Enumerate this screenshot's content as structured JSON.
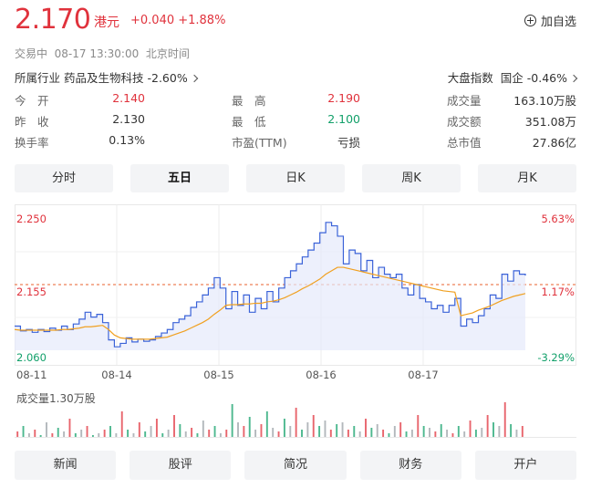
{
  "header": {
    "price": "2.170",
    "currency": "港元",
    "change": "+0.040 +1.88%",
    "watch_label": "加自选"
  },
  "status": {
    "state": "交易中",
    "time": "08-17 13:30:00",
    "zone": "北京时间"
  },
  "industry": {
    "label": "所属行业",
    "name": "药品及生物科技",
    "change": "-2.60%"
  },
  "market_index": {
    "label": "大盘指数",
    "name": "国企",
    "change": "-0.46%"
  },
  "stats": [
    [
      {
        "label": "今　开",
        "value": "2.140",
        "color": "red"
      },
      {
        "label": "最　高",
        "value": "2.190",
        "color": "red"
      },
      {
        "label": "成交量",
        "value": "163.10万股",
        "color": "normal"
      }
    ],
    [
      {
        "label": "昨　收",
        "value": "2.130",
        "color": "normal"
      },
      {
        "label": "最　低",
        "value": "2.100",
        "color": "green"
      },
      {
        "label": "成交额",
        "value": "351.08万",
        "color": "normal"
      }
    ],
    [
      {
        "label": "换手率",
        "value": "0.13%",
        "color": "normal"
      },
      {
        "label": "市盈(TTM)",
        "value": "亏损",
        "color": "normal"
      },
      {
        "label": "总市值",
        "value": "27.86亿",
        "color": "normal"
      }
    ]
  ],
  "tabs": [
    {
      "label": "分时",
      "active": false
    },
    {
      "label": "五日",
      "active": true
    },
    {
      "label": "日K",
      "active": false
    },
    {
      "label": "周K",
      "active": false
    },
    {
      "label": "月K",
      "active": false
    }
  ],
  "chart_data": {
    "type": "line",
    "title": "",
    "x_tick_labels": [
      "08-11",
      "08-14",
      "08-15",
      "08-16",
      "08-17"
    ],
    "y_ticks_price": [
      "2.250",
      "2.155",
      "2.060"
    ],
    "y_ticks_pct": [
      "5.63%",
      "1.17%",
      "-3.29%"
    ],
    "ylim": [
      2.06,
      2.25
    ],
    "prev_close": 2.13,
    "reference_price": 2.155,
    "days": 5,
    "series": [
      {
        "color": "#3a62d8",
        "values": [
          2.095,
          2.088,
          2.09,
          2.086,
          2.09,
          2.087,
          2.092,
          2.089,
          2.095,
          2.09,
          2.098,
          2.105,
          2.115,
          2.108,
          2.112,
          2.1,
          2.075,
          2.065,
          2.07,
          2.078,
          2.072,
          2.076,
          2.073,
          2.075,
          2.08,
          2.085,
          2.09,
          2.1,
          2.105,
          2.11,
          2.122,
          2.13,
          2.14,
          2.15,
          2.165,
          2.15,
          2.12,
          2.145,
          2.125,
          2.14,
          2.115,
          2.135,
          2.12,
          2.145,
          2.13,
          2.15,
          2.165,
          2.175,
          2.185,
          2.195,
          2.205,
          2.215,
          2.23,
          2.245,
          2.24,
          2.225,
          2.185,
          2.205,
          2.2,
          2.175,
          2.19,
          2.165,
          2.18,
          2.17,
          2.165,
          2.17,
          2.15,
          2.14,
          2.155,
          2.135,
          2.13,
          2.12,
          2.125,
          2.115,
          2.125,
          2.135,
          2.095,
          2.105,
          2.1,
          2.11,
          2.12,
          2.14,
          2.135,
          2.17,
          2.16,
          2.175,
          2.17,
          2.168
        ]
      },
      {
        "color": "#f0a020",
        "values": [
          2.09,
          2.089,
          2.089,
          2.089,
          2.089,
          2.089,
          2.089,
          2.089,
          2.09,
          2.09,
          2.091,
          2.092,
          2.094,
          2.094,
          2.095,
          2.096,
          2.09,
          2.082,
          2.078,
          2.077,
          2.076,
          2.076,
          2.076,
          2.076,
          2.077,
          2.078,
          2.079,
          2.082,
          2.085,
          2.088,
          2.092,
          2.096,
          2.1,
          2.105,
          2.112,
          2.118,
          2.125,
          2.126,
          2.126,
          2.127,
          2.127,
          2.128,
          2.128,
          2.13,
          2.131,
          2.133,
          2.136,
          2.14,
          2.144,
          2.149,
          2.153,
          2.158,
          2.163,
          2.17,
          2.175,
          2.18,
          2.18,
          2.178,
          2.176,
          2.174,
          2.172,
          2.17,
          2.168,
          2.166,
          2.164,
          2.162,
          2.16,
          2.158,
          2.156,
          2.154,
          2.152,
          2.15,
          2.148,
          2.146,
          2.145,
          2.144,
          2.11,
          2.112,
          2.114,
          2.118,
          2.121,
          2.124,
          2.128,
          2.132,
          2.135,
          2.138,
          2.14,
          2.142
        ]
      }
    ]
  },
  "volume": {
    "label": "成交量1.30万股",
    "bars": [
      0.15,
      0.3,
      0.1,
      0.2,
      0.05,
      0.4,
      0.1,
      0.25,
      0.15,
      0.5,
      0.1,
      0.2,
      0.3,
      0.05,
      0.1,
      0.2,
      0.3,
      0.1,
      0.7,
      0.2,
      0.1,
      0.4,
      0.15,
      0.3,
      0.5,
      0.1,
      0.2,
      0.6,
      0.35,
      0.15,
      0.25,
      0.1,
      0.45,
      0.2,
      0.3,
      0.1,
      0.2,
      0.9,
      0.4,
      0.3,
      0.55,
      0.2,
      0.35,
      0.7,
      0.25,
      0.15,
      0.5,
      0.3,
      0.8,
      0.2,
      0.4,
      0.6,
      0.3,
      0.45,
      0.2,
      0.35,
      0.4,
      0.2,
      0.3,
      0.15,
      0.5,
      0.25,
      0.35,
      0.2,
      0.1,
      0.3,
      0.4,
      0.15,
      0.2,
      0.6,
      0.3,
      0.25,
      0.15,
      0.35,
      0.2,
      0.1,
      0.3,
      0.15,
      0.45,
      0.2,
      0.25,
      0.6,
      0.4,
      0.3,
      0.95,
      0.35,
      0.2,
      0.3
    ]
  },
  "bottom_nav": [
    "新闻",
    "股评",
    "简况",
    "财务",
    "开户"
  ]
}
